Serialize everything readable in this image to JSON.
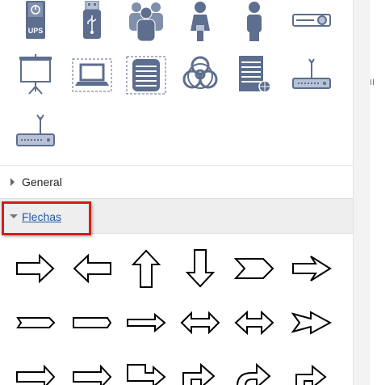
{
  "sections": {
    "general": {
      "label": "General"
    },
    "flechas": {
      "label": "Flechas"
    }
  },
  "shapes": {
    "network": [
      "ups-icon",
      "usb-drive-icon",
      "users-group-icon",
      "woman-user-icon",
      "man-user-icon",
      "projector-icon",
      "projection-screen-icon",
      "laptop-icon",
      "server-rack-icon",
      "biohazard-icon",
      "server-network-icon",
      "wireless-router-icon",
      "router-icon"
    ],
    "arrows": [
      "arrow-right-icon",
      "arrow-left-icon",
      "arrow-up-icon",
      "arrow-down-icon",
      "chevron-arrow-icon",
      "notched-arrow-icon",
      "callout-arrow-right-icon",
      "callout-left-icon",
      "thin-arrow-right-icon",
      "double-arrow-icon",
      "double-arrow-wide-icon",
      "striped-arrow-icon",
      "arrow-right-partial-icon",
      "arrow-right-partial-2-icon",
      "callout-bent-icon",
      "bent-arrow-icon",
      "curved-arrow-icon",
      "bent-arrow-2-icon"
    ]
  },
  "colors": {
    "icon_fill": "#5d6e8e",
    "icon_light": "#b8c2d6",
    "highlight_border": "#d21e1e",
    "link": "#1f5aa8"
  }
}
